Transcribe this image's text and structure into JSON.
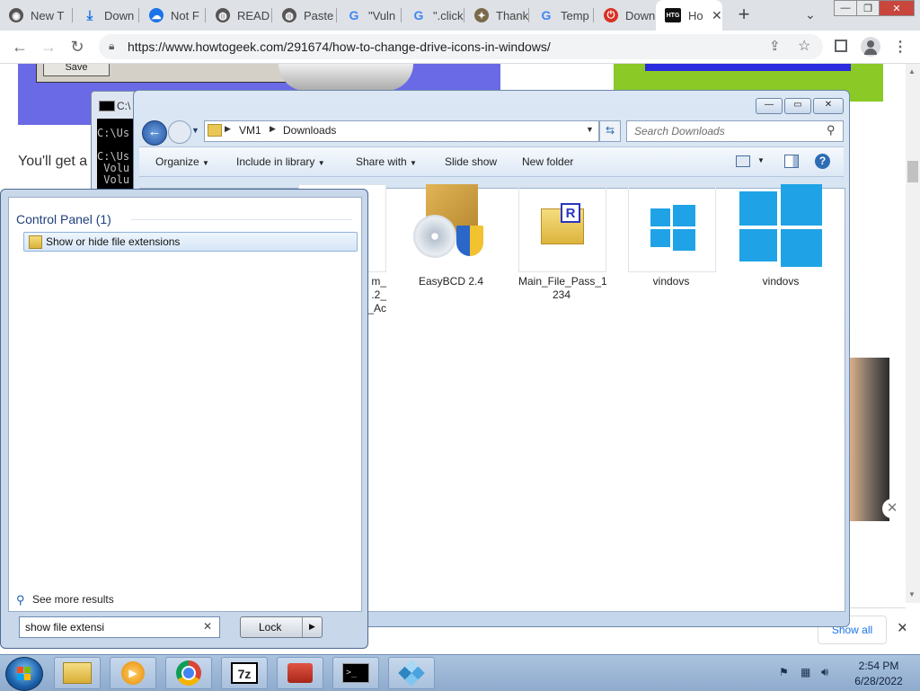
{
  "browser": {
    "tabs": [
      {
        "label": "New T"
      },
      {
        "label": "Down"
      },
      {
        "label": "Not F"
      },
      {
        "label": "READ"
      },
      {
        "label": "Paste"
      },
      {
        "label": "\"Vuln"
      },
      {
        "label": "\".click"
      },
      {
        "label": "Thank"
      },
      {
        "label": "Temp"
      },
      {
        "label": "Down"
      },
      {
        "label": "Ho"
      }
    ],
    "active_tab_favicon": "HTG",
    "url": "https://www.howtogeek.com/291674/how-to-change-drive-icons-in-windows/"
  },
  "webpage": {
    "save_label": "Save",
    "paragraph_start": "You'll get a",
    "show_all_label": "Show all",
    "accent_green": "#8ac926",
    "accent_blue": "#2a2adf"
  },
  "console": {
    "title": "C:\\",
    "lines": [
      "C:\\Us",
      "C:\\Us",
      " Volu",
      " Volu"
    ]
  },
  "explorer": {
    "breadcrumb": [
      "VM1",
      "Downloads"
    ],
    "search_placeholder": "Search Downloads",
    "toolbar": {
      "organize": "Organize",
      "include_in_library": "Include in library",
      "share_with": "Share with",
      "slide_show": "Slide show",
      "new_folder": "New folder"
    },
    "files": [
      {
        "name": "m_\n.2_\n_Ac"
      },
      {
        "name": "EasyBCD 2.4"
      },
      {
        "name": "Main_File_Pass_1\n234"
      },
      {
        "name": "vindovs"
      },
      {
        "name": "vindovs"
      }
    ]
  },
  "startmenu": {
    "group_header": "Control Panel (1)",
    "results": [
      {
        "label": "Show or hide file extensions"
      }
    ],
    "see_more": "See more results",
    "search_value": "show file extensi",
    "lock_label": "Lock"
  },
  "taskbar": {
    "time": "2:54 PM",
    "date": "6/28/2022",
    "apps": [
      "explorer-icon",
      "media-player-icon",
      "chrome-icon",
      "7zip-icon",
      "toolbox-icon",
      "cmd-icon",
      "registry-icon"
    ]
  }
}
